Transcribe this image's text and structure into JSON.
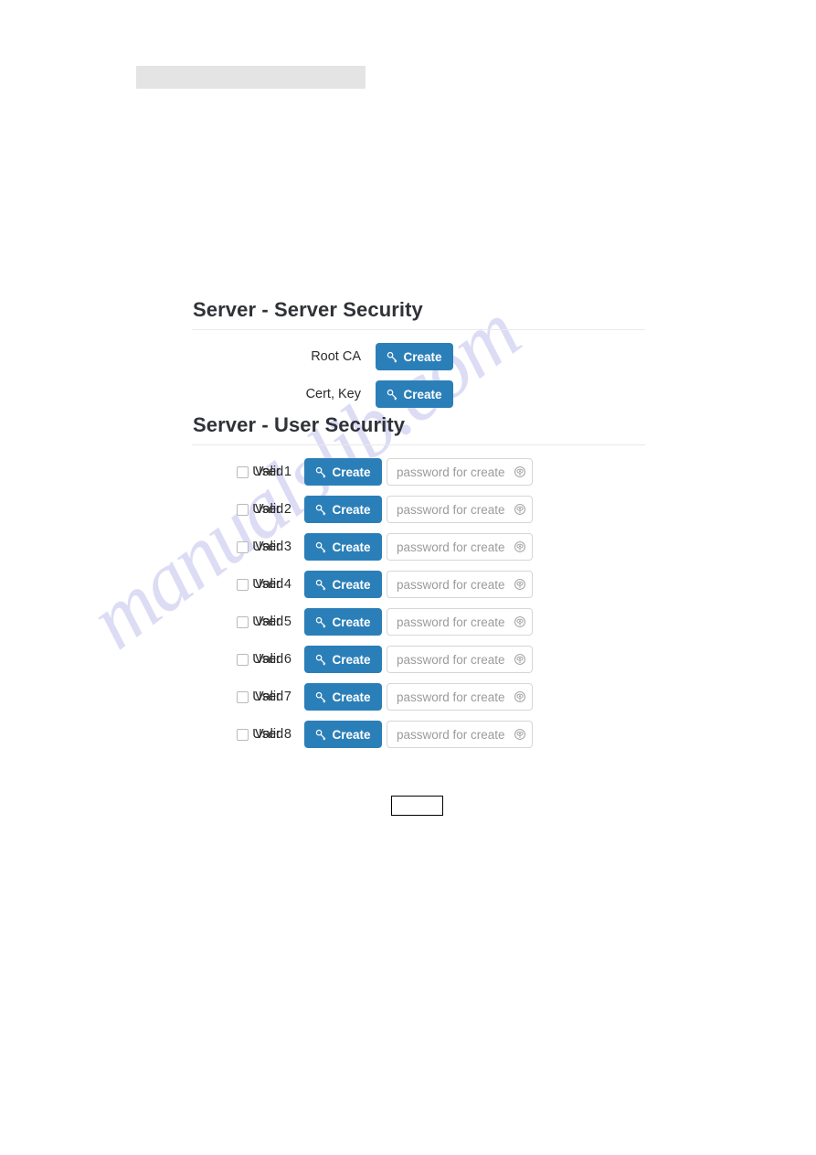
{
  "page": {
    "background_color": "#ffffff",
    "accent_color": "#2b7fb8",
    "top_bar": {
      "label": "",
      "color": "#e4e4e4"
    },
    "watermark": {
      "text": "manualslib.com",
      "color": "#c9c8f0"
    }
  },
  "sections": [
    {
      "title": "Server - Server Security",
      "rows": [
        {
          "label": "Root CA",
          "button_label": "Create",
          "button_icon": "key-icon"
        },
        {
          "label": "Cert, Key",
          "button_label": "Create",
          "button_icon": "key-icon"
        }
      ]
    },
    {
      "title": "Server - User Security",
      "valid_label": "Valid",
      "password_placeholder": "password for create",
      "reveal_icon": "eye-circle-icon",
      "rows": [
        {
          "label": "User 1",
          "valid_label": "Valid",
          "valid_checked": false,
          "button_label": "Create",
          "button_icon": "key-icon",
          "password_value": "",
          "password_placeholder": "password for create"
        },
        {
          "label": "User 2",
          "valid_label": "Valid",
          "valid_checked": false,
          "button_label": "Create",
          "button_icon": "key-icon",
          "password_value": "",
          "password_placeholder": "password for create"
        },
        {
          "label": "User 3",
          "valid_label": "Valid",
          "valid_checked": false,
          "button_label": "Create",
          "button_icon": "key-icon",
          "password_value": "",
          "password_placeholder": "password for create"
        },
        {
          "label": "User 4",
          "valid_label": "Valid",
          "valid_checked": false,
          "button_label": "Create",
          "button_icon": "key-icon",
          "password_value": "",
          "password_placeholder": "password for create"
        },
        {
          "label": "User 5",
          "valid_label": "Valid",
          "valid_checked": false,
          "button_label": "Create",
          "button_icon": "key-icon",
          "password_value": "",
          "password_placeholder": "password for create"
        },
        {
          "label": "User 6",
          "valid_label": "Valid",
          "valid_checked": false,
          "button_label": "Create",
          "button_icon": "key-icon",
          "password_value": "",
          "password_placeholder": "password for create"
        },
        {
          "label": "User 7",
          "valid_label": "Valid",
          "valid_checked": false,
          "button_label": "Create",
          "button_icon": "key-icon",
          "password_value": "",
          "password_placeholder": "password for create"
        },
        {
          "label": "User 8",
          "valid_label": "Valid",
          "valid_checked": false,
          "button_label": "Create",
          "button_icon": "key-icon",
          "password_value": "",
          "password_placeholder": "password for create"
        }
      ]
    }
  ],
  "footer": {
    "submit_button_label": ""
  }
}
